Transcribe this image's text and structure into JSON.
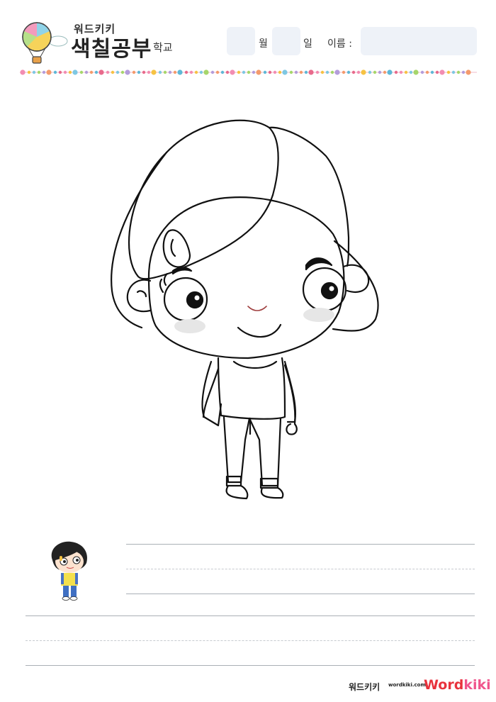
{
  "header": {
    "brand_small": "워드키키",
    "brand_big": "색칠공부",
    "school": "학교",
    "month_label": "월",
    "day_label": "일",
    "name_label": "이름 :"
  },
  "footer": {
    "brand_korean": "워드키키",
    "url": "wordkiki.com",
    "logo_word": "Word",
    "logo_kiki": "kiki"
  },
  "colors": {
    "field_bg": "#eef2f8",
    "line": "#aab0b6",
    "logo_red": "#e8323c",
    "logo_pink": "#f0558c",
    "cheek": "#e6e6e6"
  },
  "icons": [
    "hot-air-balloon-icon",
    "girl-coloring-outline",
    "girl-color-thumbnail"
  ]
}
